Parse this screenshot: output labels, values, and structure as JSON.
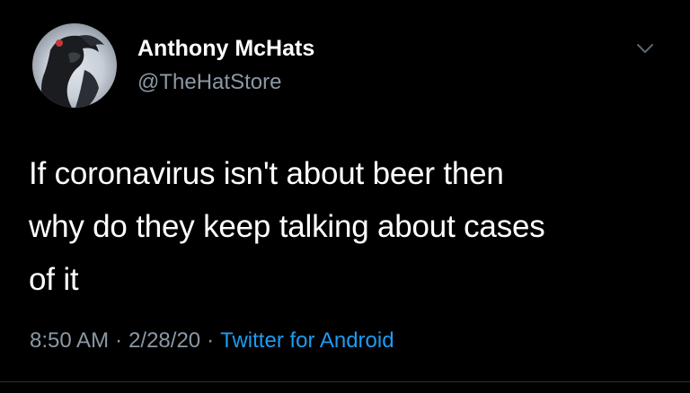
{
  "author": {
    "name": "Anthony McHats",
    "handle": "@TheHatStore",
    "avatar_icon": "profile-photo-icon"
  },
  "menu_icon": "chevron-down-icon",
  "tweet": {
    "lines": [
      "If coronavirus isn't about beer then",
      "why do they keep talking about cases",
      "of it"
    ]
  },
  "meta": {
    "time": "8:50 AM",
    "separator": "·",
    "date": "2/28/20",
    "source": "Twitter for Android"
  },
  "colors": {
    "background": "#000000",
    "text": "#ffffff",
    "muted": "#8b98a5",
    "link": "#1d9bf0"
  }
}
